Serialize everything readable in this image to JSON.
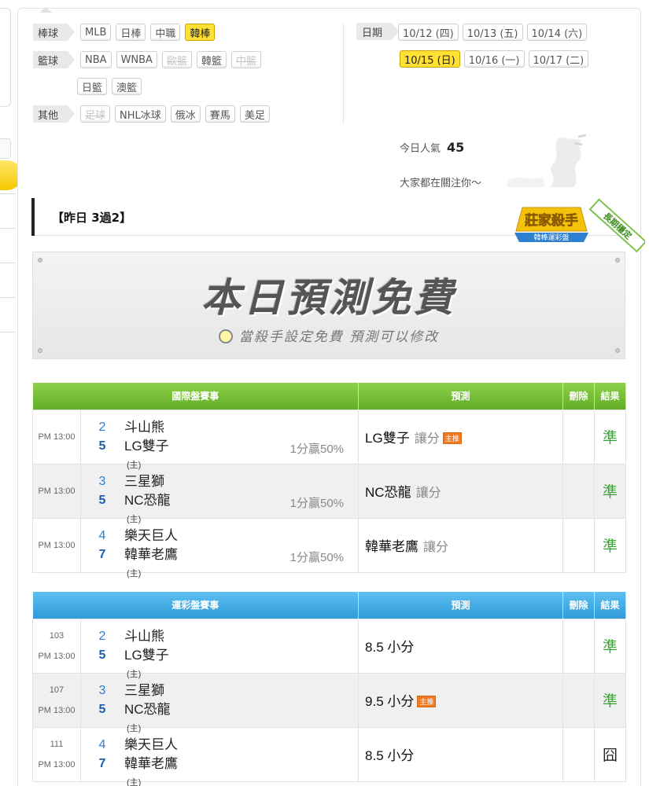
{
  "categories": [
    {
      "label": "棒球",
      "chips": [
        {
          "t": "MLB",
          "s": "normal"
        },
        {
          "t": "日棒",
          "s": "normal"
        },
        {
          "t": "中職",
          "s": "normal"
        },
        {
          "t": "韓棒",
          "s": "active"
        }
      ]
    },
    {
      "label": "籃球",
      "chips": [
        {
          "t": "NBA",
          "s": "normal"
        },
        {
          "t": "WNBA",
          "s": "normal"
        },
        {
          "t": "歐籃",
          "s": "disabled"
        },
        {
          "t": "韓籃",
          "s": "normal"
        },
        {
          "t": "中籃",
          "s": "disabled"
        }
      ]
    },
    {
      "label": "",
      "chips": [
        {
          "t": "日籃",
          "s": "normal"
        },
        {
          "t": "澳籃",
          "s": "normal"
        }
      ]
    },
    {
      "label": "其他",
      "chips": [
        {
          "t": "足球",
          "s": "disabled"
        },
        {
          "t": "NHL冰球",
          "s": "normal"
        },
        {
          "t": "俄冰",
          "s": "normal"
        },
        {
          "t": "賽馬",
          "s": "normal"
        },
        {
          "t": "美足",
          "s": "normal"
        }
      ]
    }
  ],
  "dates": {
    "label": "日期",
    "row1": [
      {
        "t": "10/12 (四)",
        "s": "normal"
      },
      {
        "t": "10/13 (五)",
        "s": "normal"
      },
      {
        "t": "10/14 (六)",
        "s": "normal"
      }
    ],
    "row2": [
      {
        "t": "10/15 (日)",
        "s": "active"
      },
      {
        "t": "10/16 (一)",
        "s": "normal"
      },
      {
        "t": "10/17 (二)",
        "s": "normal"
      }
    ]
  },
  "popularity": {
    "label": "今日人氣",
    "value": "45",
    "tagline": "大家都在關注你～"
  },
  "record": "【昨日 3過2】",
  "badge": {
    "title": "莊家殺手",
    "sub": "韓棒運彩盤",
    "ribbon": "長期穩定"
  },
  "free_banner": {
    "title": "本日預測免費",
    "subtitle": "當殺手設定免費 預測可以修改"
  },
  "intl": {
    "headers": {
      "event": "國際盤賽事",
      "predict": "預測",
      "delete": "刪除",
      "result": "結果"
    },
    "rows": [
      {
        "time": "PM 13:00",
        "n1": "2",
        "t1": "斗山熊",
        "n2": "5",
        "t2": "LG雙子",
        "host": "(主)",
        "odds": "1分贏50%",
        "pick": "LG雙子",
        "type": "讓分",
        "tag": "主推",
        "result": "準"
      },
      {
        "time": "PM 13:00",
        "n1": "3",
        "t1": "三星獅",
        "n2": "5",
        "t2": "NC恐龍",
        "host": "(主)",
        "odds": "1分贏50%",
        "pick": "NC恐龍",
        "type": "讓分",
        "tag": "",
        "result": "準"
      },
      {
        "time": "PM 13:00",
        "n1": "4",
        "t1": "樂天巨人",
        "n2": "7",
        "t2": "韓華老鷹",
        "host": "(主)",
        "odds": "1分贏50%",
        "pick": "韓華老鷹",
        "type": "讓分",
        "tag": "",
        "result": "準"
      }
    ]
  },
  "lottery": {
    "headers": {
      "event": "運彩盤賽事",
      "predict": "預測",
      "delete": "刪除",
      "result": "結果"
    },
    "rows": [
      {
        "code": "103",
        "time": "PM 13:00",
        "n1": "2",
        "t1": "斗山熊",
        "n2": "5",
        "t2": "LG雙子",
        "host": "(主)",
        "pick": "8.5 小分",
        "tag": "",
        "result": "準"
      },
      {
        "code": "107",
        "time": "PM 13:00",
        "n1": "3",
        "t1": "三星獅",
        "n2": "5",
        "t2": "NC恐龍",
        "host": "(主)",
        "pick": "9.5 小分",
        "tag": "主推",
        "result": "準"
      },
      {
        "code": "111",
        "time": "PM 13:00",
        "n1": "4",
        "t1": "樂天巨人",
        "n2": "7",
        "t2": "韓華老鷹",
        "host": "(主)",
        "pick": "8.5 小分",
        "tag": "",
        "result": "囧"
      }
    ]
  },
  "colors": {
    "accent_yellow": "#ffe033",
    "green_header": "#63ad27",
    "blue_header": "#2e9ad8",
    "result_green": "#3aa534"
  }
}
